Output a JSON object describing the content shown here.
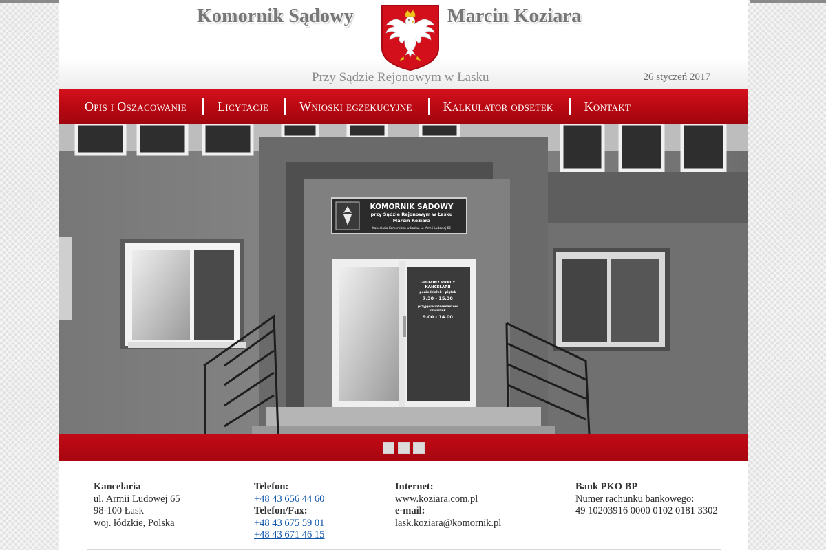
{
  "header": {
    "title_left": "Komornik Sądowy",
    "title_right": "Marcin Koziara",
    "subtitle": "Przy Sądzie Rejonowym w Łasku",
    "date": "26 styczeń 2017",
    "emblem_icon": "polish-eagle-emblem"
  },
  "nav": {
    "items": [
      {
        "label": "Opis i Oszacowanie"
      },
      {
        "label": "Licytacje"
      },
      {
        "label": "Wnioski egzekucyjne"
      },
      {
        "label": "Kalkulator odsetek"
      },
      {
        "label": "Kontakt"
      }
    ]
  },
  "hero": {
    "sign_line1": "KOMORNIK SĄDOWY",
    "sign_line2": "przy Sądzie Rejonowym w Łasku",
    "sign_line3": "Marcin Koziara",
    "sign_line4": "Kancelaria Komornicza w Łasku, ul. Armii Ludowej 65",
    "door_line1": "GODZINY PRACY",
    "door_line2": "KANCELARII",
    "door_line3": "poniedziałek - piątek",
    "door_line4": "7.30 - 15.30",
    "door_line5": "przyjęcia interesantów",
    "door_line6": "czwartek",
    "door_line7": "9.00 - 14.00"
  },
  "slider": {
    "dot_count": 3,
    "active_index": 0
  },
  "footer": {
    "office": {
      "heading": "Kancelaria",
      "line1": "ul. Armii Ludowej 65",
      "line2": "98-100 Łask",
      "line3": "woj. łódzkie, Polska"
    },
    "phone": {
      "heading": "Telefon:",
      "number": "+48 43 656 44 60",
      "fax_heading": "Telefon/Fax:",
      "fax1": "+48 43 675 59 01",
      "fax2": "+48 43 671 46 15"
    },
    "internet": {
      "heading": "Internet:",
      "url": "www.koziara.com.pl",
      "email_heading": "e-mail:",
      "email": "lask.koziara@komornik.pl"
    },
    "bank": {
      "heading": "Bank PKO BP",
      "label": "Numer rachunku bankowego:",
      "account": "49 10203916 0000 0102 0181 3302"
    }
  },
  "colors": {
    "nav_red": "#b70812",
    "link_blue": "#1155aa",
    "title_gray": "#777777"
  }
}
